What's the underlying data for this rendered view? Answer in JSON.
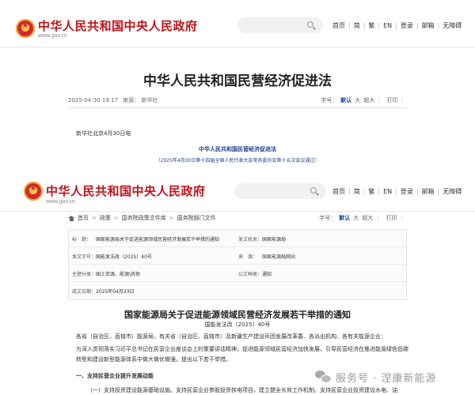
{
  "header": {
    "site_title": "中华人民共和国中央人民政府",
    "site_url": "www.gov.cn",
    "nav": [
      "首页",
      "简",
      "繁",
      "EN",
      "登录",
      "邮箱",
      "无障碍"
    ]
  },
  "article1": {
    "title": "中华人民共和国民营经济促进法",
    "datetime": "2025-04-30 19:17",
    "source": "来源： 新华社",
    "font_label": "字号：",
    "font_default": "默认",
    "font_large": "大",
    "font_xlarge": "超大",
    "print": "打印",
    "dateline": "新华社北京4月30日电",
    "law_title": "中华人民共和国民营经济促进法",
    "law_subtitle": "（2025年4月30日第十四届全国人民代表大会常务委员会第十五次会议通过）"
  },
  "article2": {
    "breadcrumb": [
      "首页",
      "政策",
      "国务院政策文件库",
      "国务院部门文件"
    ],
    "font_label": "字号：",
    "font_default": "默认",
    "font_large": "大",
    "font_xlarge": "超大",
    "print": "打印",
    "info": {
      "title_label": "标　题：",
      "title_value": "国家能源局关于促进能源领域民营经济发展若干举措的通知",
      "issuer_label": "发文机关：",
      "issuer_value": "国家能源局",
      "number_label": "发文字号：",
      "number_value": "国能发法改〔2025〕40号",
      "source_label": "来　源：",
      "source_value": "国家能源局网站",
      "topic_label": "主题分类：",
      "topic_value": "国土资源、能源\\其他",
      "type_label": "公文种类：",
      "type_value": "通知",
      "date_label": "成文日期：",
      "date_value": "2025年04月23日"
    },
    "doc_title": "国家能源局关于促进能源领域民营经济发展若干举措的通知",
    "doc_number": "国能发法改〔2025〕40号",
    "p1": "各省（自治区、直辖市）能源局，有关省（自治区、直辖市）及新疆生产建设兵团发展改革委、各派出机构、各有关能源企业：",
    "p2": "为深入贯彻落实习近平总书记在民营企业座谈会上的重要讲话精神，促进能源领域民营经济加快发展，引导民营经济在推进能源绿色低碳转型和建设新型能源体系中做大做优做强，提出以下若干举措。",
    "p3": "一、支持民营企业提升发展动能",
    "p4": "（一）支持投资建设能源基础设施。支持民营企业参股投资核电项目，建立健全长效工作机制。支持民营企业投资建设水电、油"
  },
  "watermark": "服务号 · 涅康新能源"
}
